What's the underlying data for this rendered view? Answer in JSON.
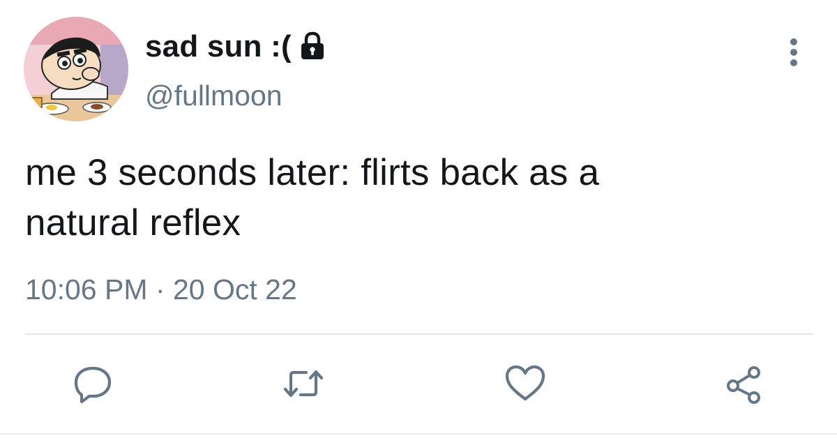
{
  "tweet": {
    "display_name": "sad sun :(",
    "handle": "@fullmoon",
    "protected_icon": "lock-icon",
    "text_line_1": "me 3 seconds later: flirts back as a",
    "text_line_2": "natural reflex",
    "time": "10:06 PM",
    "separator": "·",
    "date": "20 Oct 22"
  },
  "actions": {
    "reply_icon": "speech-bubble-icon",
    "retweet_icon": "retweet-icon",
    "like_icon": "heart-icon",
    "share_icon": "share-icon"
  },
  "colors": {
    "text_primary": "#14171a",
    "text_secondary": "#657786",
    "icon": "#657786",
    "divider": "#e1e8ed"
  }
}
